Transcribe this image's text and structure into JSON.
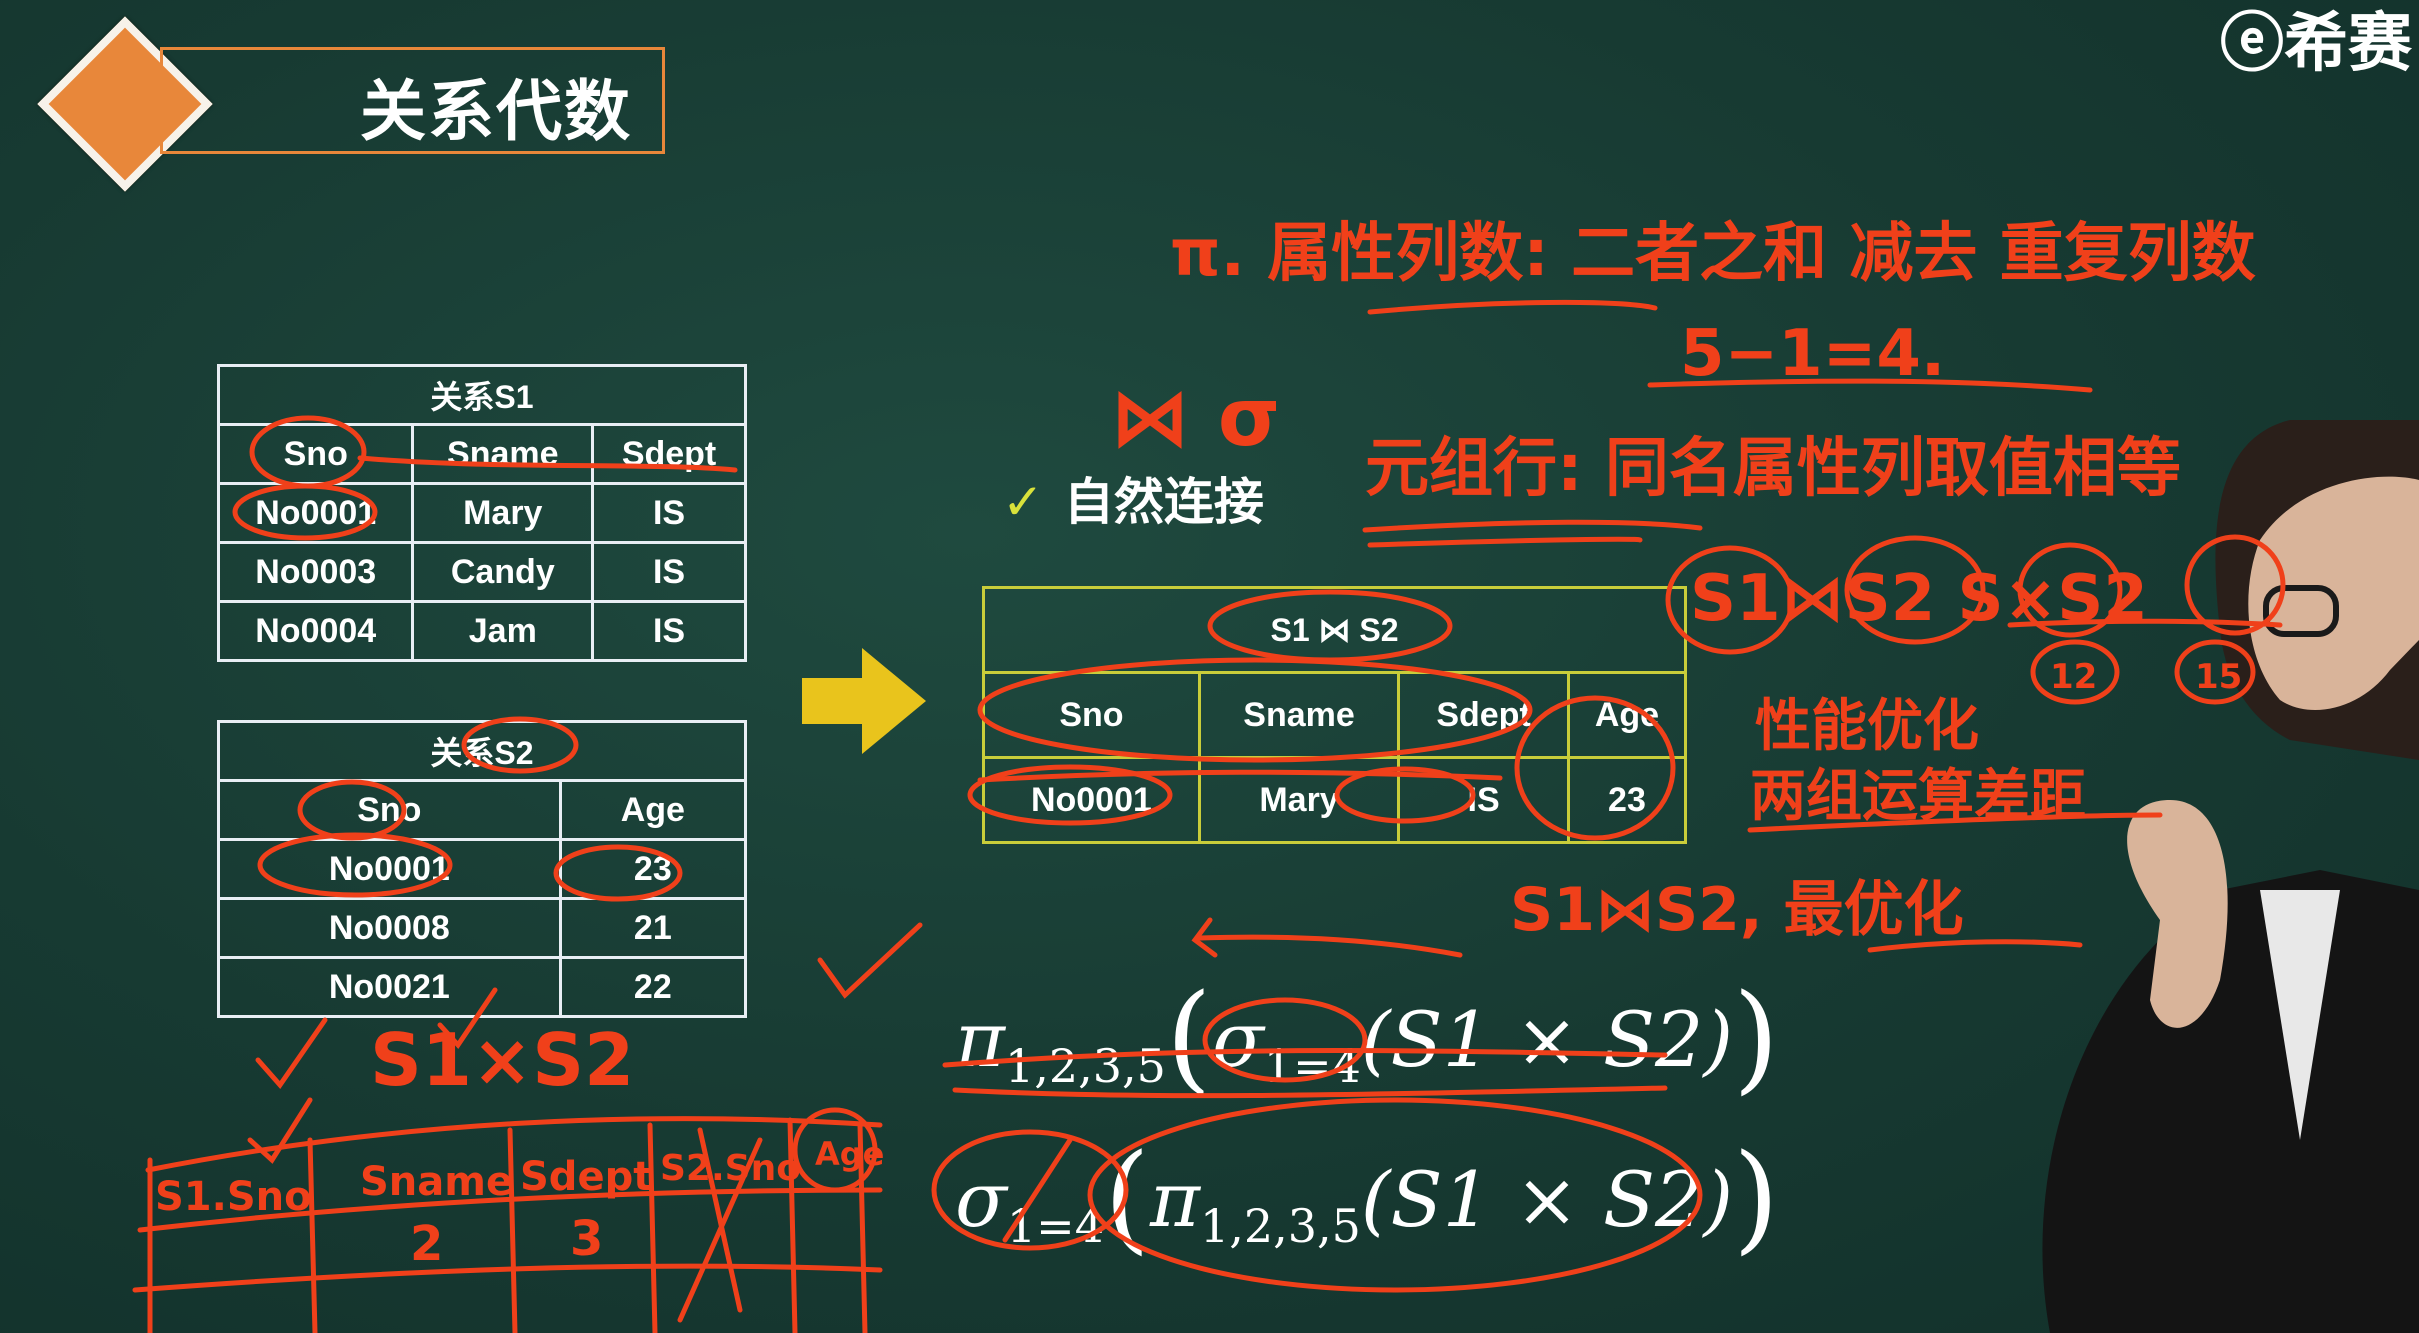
{
  "header": {
    "title": "关系代数",
    "logo_text": "ⓔ希赛"
  },
  "table_s1": {
    "caption": "关系S1",
    "columns": [
      "Sno",
      "Sname",
      "Sdept"
    ],
    "rows": [
      [
        "No0001",
        "Mary",
        "IS"
      ],
      [
        "No0003",
        "Candy",
        "IS"
      ],
      [
        "No0004",
        "Jam",
        "IS"
      ]
    ]
  },
  "table_s2": {
    "caption": "关系S2",
    "columns": [
      "Sno",
      "Age"
    ],
    "rows": [
      [
        "No0001",
        "23"
      ],
      [
        "No0008",
        "21"
      ],
      [
        "No0021",
        "22"
      ]
    ]
  },
  "natural_join": {
    "label": "自然连接",
    "check_glyph": "✓",
    "caption": "S1 ⋈ S2",
    "columns": [
      "Sno",
      "Sname",
      "Sdept",
      "Age"
    ],
    "rows": [
      [
        "No0001",
        "Mary",
        "IS",
        "23"
      ]
    ]
  },
  "formulas": {
    "f1": {
      "pi": "π",
      "pi_sub": "1,2,3,5",
      "open": "(",
      "sigma": "σ",
      "sigma_sub": "1=4",
      "body": "(S1 × S2)",
      "close": ")"
    },
    "f2": {
      "sigma": "σ",
      "sigma_sub": "1=4",
      "open": "(",
      "pi": "π",
      "pi_sub": "1,2,3,5",
      "body": "(S1 × S2)",
      "close": ")"
    }
  },
  "handwriting": {
    "line1": "π. 属性列数: 二者之和 减去 重复列数",
    "line1b": "5−1=4.",
    "symbols": "⋈ σ",
    "line2": "元组行: 同名属性列取值相等",
    "line3": "S1⋈S2  S×S2",
    "circled": [
      "12",
      "15"
    ],
    "line4": "性能优化",
    "line5": "两组运算差距",
    "line6": "S1⋈S2, 最优化",
    "cross_label": "S1×S2",
    "cross_header": [
      "S1.Sno",
      "Sname",
      "Sdept",
      "S2.Sno",
      "Age"
    ],
    "cross_row": [
      "",
      "2",
      "3",
      "",
      ""
    ]
  },
  "colors": {
    "board": "#173a32",
    "accent_orange": "#e8873a",
    "ink_red": "#f0401a",
    "join_table_border": "#c9cd3a",
    "arrow_yellow": "#e9c41c"
  }
}
